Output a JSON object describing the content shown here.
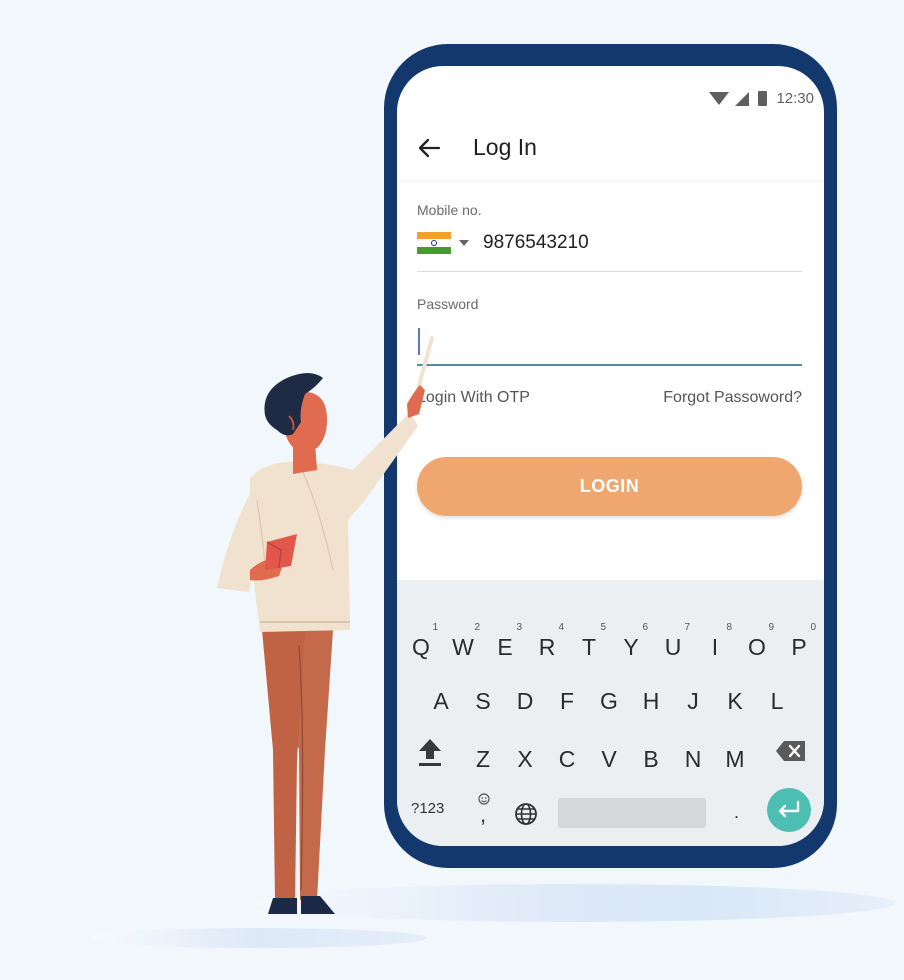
{
  "status": {
    "time": "12:30",
    "icons": [
      "wifi-icon",
      "signal-icon",
      "battery-icon"
    ]
  },
  "header": {
    "back_icon": "arrow-left-icon",
    "title": "Log In"
  },
  "form": {
    "mobile_label": "Mobile no.",
    "country_flag": "india-flag-icon",
    "mobile_value": "9876543210",
    "password_label": "Password",
    "password_value": ""
  },
  "links": {
    "otp": "Login With OTP",
    "forgot": "Forgot Passoword?"
  },
  "button": {
    "login": "LOGIN"
  },
  "keyboard": {
    "row1": [
      {
        "k": "Q",
        "n": "1"
      },
      {
        "k": "W",
        "n": "2"
      },
      {
        "k": "E",
        "n": "3"
      },
      {
        "k": "R",
        "n": "4"
      },
      {
        "k": "T",
        "n": "5"
      },
      {
        "k": "Y",
        "n": "6"
      },
      {
        "k": "U",
        "n": "7"
      },
      {
        "k": "I",
        "n": "8"
      },
      {
        "k": "O",
        "n": "9"
      },
      {
        "k": "P",
        "n": "0"
      }
    ],
    "row2": [
      "A",
      "S",
      "D",
      "F",
      "G",
      "H",
      "J",
      "K",
      "L"
    ],
    "row3": [
      "Z",
      "X",
      "C",
      "V",
      "B",
      "N",
      "M"
    ],
    "symbols_key": "?123",
    "comma_key": ",",
    "period_key": "."
  },
  "colors": {
    "phone_frame": "#12386e",
    "accent_button": "#f0a76f",
    "enter_key": "#4dbfb2",
    "background": "#f2f7fc"
  }
}
